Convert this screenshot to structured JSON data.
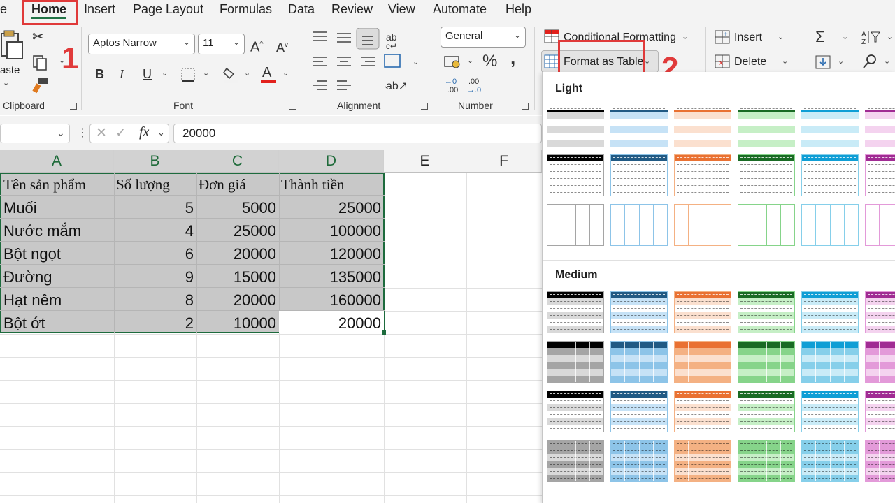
{
  "menu": {
    "items": [
      "e",
      "Home",
      "Insert",
      "Page Layout",
      "Formulas",
      "Data",
      "Review",
      "View",
      "Automate",
      "Help"
    ],
    "active": "Home"
  },
  "annotations": {
    "step1": "1",
    "step2": "2",
    "color": "#e03a3a"
  },
  "ribbon": {
    "clipboard": {
      "paste_label": "aste",
      "group_label": "Clipboard"
    },
    "font": {
      "font_name": "Aptos Narrow",
      "font_size": "11",
      "bold": "B",
      "italic": "I",
      "underline": "U",
      "grow": "A",
      "shrink": "A",
      "font_color_glyph": "A",
      "group_label": "Font"
    },
    "alignment": {
      "group_label": "Alignment"
    },
    "number": {
      "format": "General",
      "percent": "%",
      "comma": ",",
      "group_label": "Number"
    },
    "styles": {
      "conditional_formatting": "Conditional Formatting",
      "format_as_table": "Format as Table"
    },
    "cells": {
      "insert": "Insert",
      "delete": "Delete"
    },
    "editing": {
      "sum": "Σ"
    }
  },
  "formula_bar": {
    "fx": "fx",
    "value": "20000"
  },
  "sheet": {
    "columns": [
      "A",
      "B",
      "C",
      "D",
      "E",
      "F"
    ],
    "selected_columns": [
      "A",
      "B",
      "C",
      "D"
    ],
    "header_row": [
      "Tên sản phẩm",
      "Số lượng",
      "Đơn giá",
      "Thành tiền"
    ],
    "rows": [
      [
        "Muối",
        "5",
        "5000",
        "25000"
      ],
      [
        "Nước mắm",
        "4",
        "25000",
        "100000"
      ],
      [
        "Bột ngọt",
        "6",
        "20000",
        "120000"
      ],
      [
        "Đường",
        "9",
        "15000",
        "135000"
      ],
      [
        "Hạt nêm",
        "8",
        "20000",
        "160000"
      ],
      [
        "Bột ớt",
        "2",
        "10000",
        "20000"
      ]
    ]
  },
  "gallery": {
    "sections": [
      {
        "title": "Light",
        "style": "light"
      },
      {
        "title": "Medium",
        "style": "medium"
      }
    ],
    "colors": [
      {
        "name": "black",
        "dark": "#000000",
        "mid": "#a5a5a5",
        "light": "#d9d9d9"
      },
      {
        "name": "blue",
        "dark": "#215a84",
        "mid": "#8dc4e8",
        "light": "#c6e2f6"
      },
      {
        "name": "orange",
        "dark": "#e97132",
        "mid": "#f4b183",
        "light": "#fbe0cf"
      },
      {
        "name": "green",
        "dark": "#196b24",
        "mid": "#86d48a",
        "light": "#c6efc6"
      },
      {
        "name": "cyan",
        "dark": "#0f9ed5",
        "mid": "#86cfea",
        "light": "#c9ebf7"
      },
      {
        "name": "purple",
        "dark": "#a02b93",
        "mid": "#e39ad9",
        "light": "#f4d3ef"
      }
    ]
  }
}
